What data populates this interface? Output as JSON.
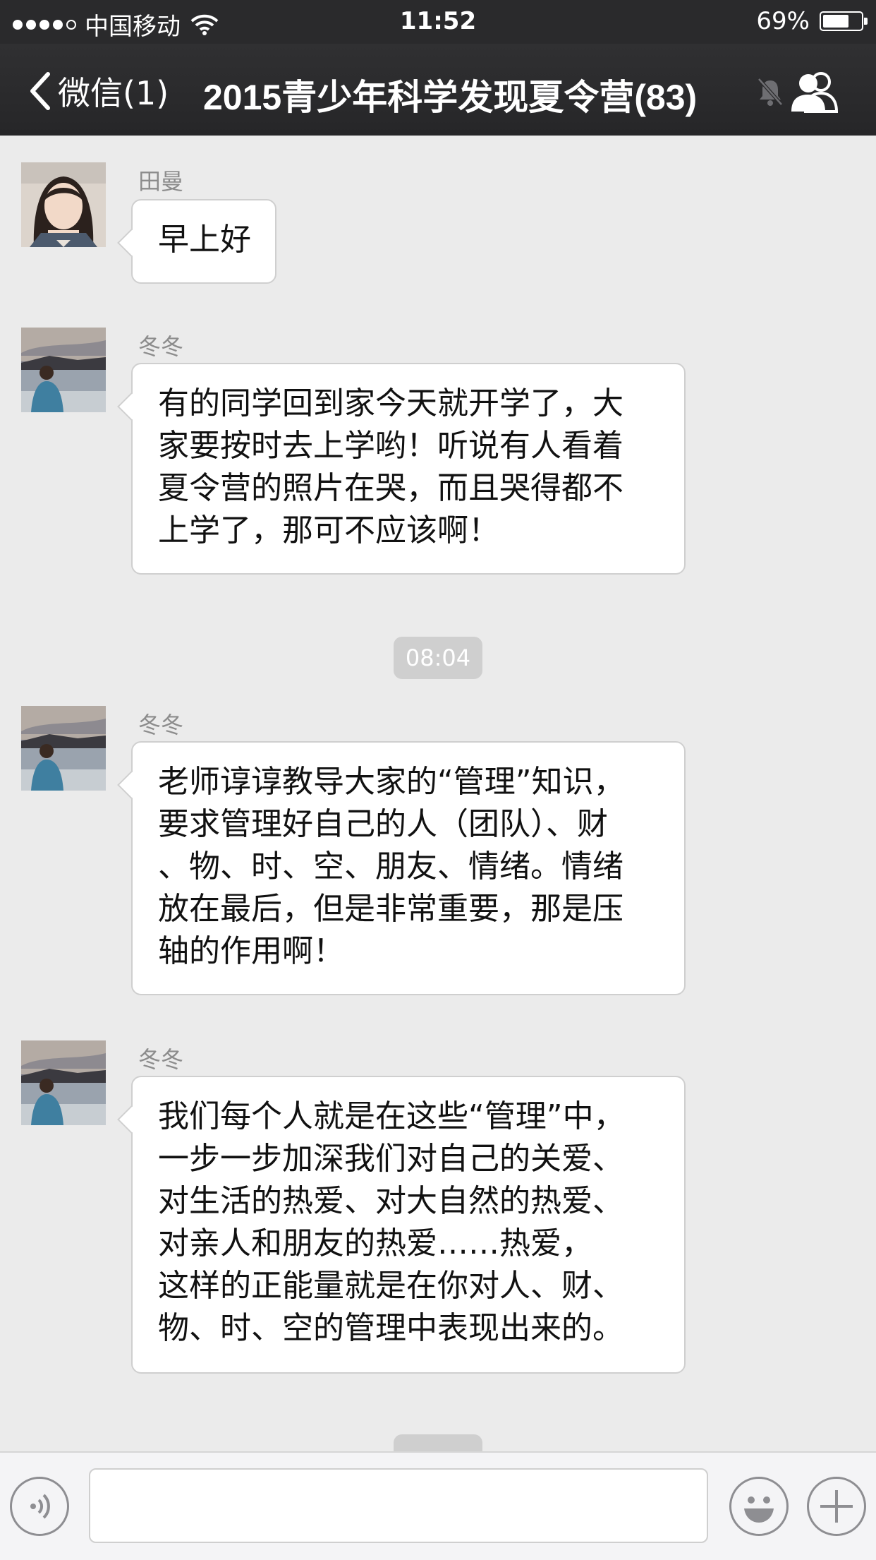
{
  "status_bar": {
    "carrier": "中国移动",
    "time": "11:52",
    "battery_percent": "69%",
    "battery_level": 0.69,
    "signal_icon": "signal-dots-icon",
    "wifi_icon": "wifi-icon"
  },
  "nav": {
    "back_label": "微信(1)",
    "title": "2015青少年科学发现夏令营(83)",
    "mute_icon": "mute-bell-icon",
    "group_icon": "group-members-icon"
  },
  "messages": [
    {
      "sender": "田曼",
      "text": "早上好",
      "avatar": "avatar-tianman"
    },
    {
      "sender": "冬冬",
      "text": "有的同学回到家今天就开学了，大\n家要按时去上学哟！听说有人看着\n夏令营的照片在哭，而且哭得都不\n上学了，那可不应该啊！",
      "avatar": "avatar-dongdong"
    },
    {
      "timestamp": "08:04"
    },
    {
      "sender": "冬冬",
      "text": "老师谆谆教导大家的“管理”知识，\n要求管理好自己的人（团队）、财\n、物、时、空、朋友、情绪。情绪\n放在最后，但是非常重要，那是压\n轴的作用啊！",
      "avatar": "avatar-dongdong"
    },
    {
      "sender": "冬冬",
      "text": "我们每个人就是在这些“管理”中，\n一步一步加深我们对自己的关爱、\n对生活的热爱、对大自然的热爱、\n对亲人和朋友的热爱……热爱，\n这样的正能量就是在你对人、财、\n物、时、空的管理中表现出来的。",
      "avatar": "avatar-dongdong"
    }
  ],
  "input_bar": {
    "voice_icon": "voice-icon",
    "emoji_icon": "emoji-icon",
    "plus_icon": "plus-icon",
    "text_value": ""
  },
  "colors": {
    "nav_bg": "#2a2a2c",
    "chat_bg": "#ebebeb",
    "bubble_bg": "#ffffff",
    "timestamp_bg": "#cfcfcf"
  }
}
